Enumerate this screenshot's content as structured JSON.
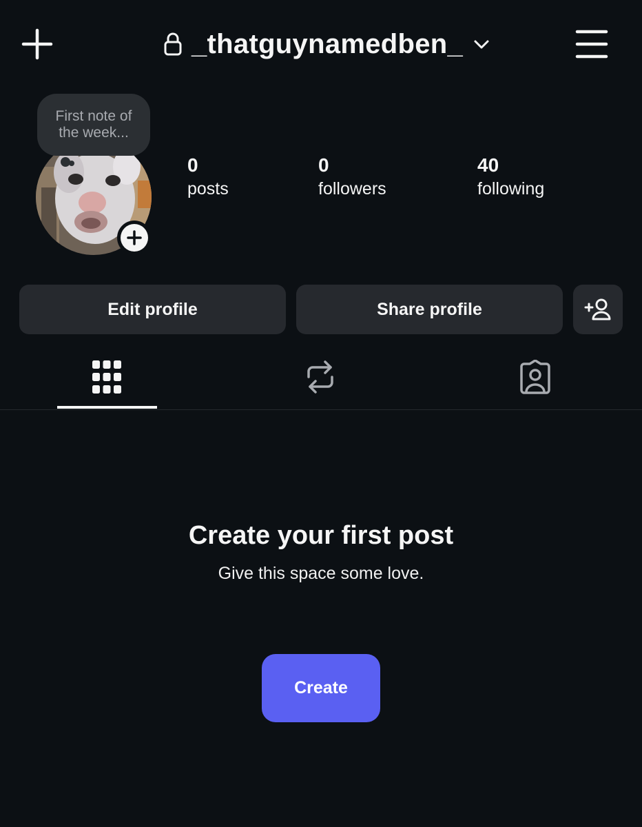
{
  "header": {
    "username": "_thatguynamedben_",
    "icons": {
      "new": "plus-icon",
      "private": "lock-icon",
      "switch_account": "chevron-down-icon",
      "menu": "hamburger-menu-icon"
    }
  },
  "note": {
    "text": "First note of the week..."
  },
  "avatar": {
    "add_icon": "plus-icon"
  },
  "stats": [
    {
      "value": "0",
      "label": "posts"
    },
    {
      "value": "0",
      "label": "followers"
    },
    {
      "value": "40",
      "label": "following"
    }
  ],
  "actions": {
    "edit_label": "Edit profile",
    "share_label": "Share profile",
    "discover_icon": "add-person-icon"
  },
  "tabs": [
    {
      "icon": "grid-icon",
      "active": true
    },
    {
      "icon": "repost-icon",
      "active": false
    },
    {
      "icon": "tagged-person-icon",
      "active": false
    }
  ],
  "empty_state": {
    "title": "Create your first post",
    "subtitle": "Give this space some love.",
    "button_label": "Create"
  },
  "colors": {
    "background": "#0c1014",
    "button_background": "#26292e",
    "note_background": "#2b2f33",
    "accent": "#5a60f2",
    "text": "#f5f5f5",
    "inactive_icon": "#a8abb0"
  }
}
